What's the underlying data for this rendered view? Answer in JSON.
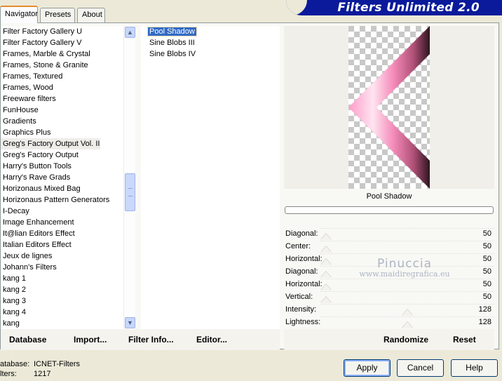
{
  "tabs": [
    {
      "label": "Navigator"
    },
    {
      "label": "Presets"
    },
    {
      "label": "About"
    }
  ],
  "banner": {
    "title": "Filters Unlimited 2.0"
  },
  "categories": [
    "Filter Factory Gallery U",
    "Filter Factory Gallery V",
    "Frames, Marble & Crystal",
    "Frames, Stone & Granite",
    "Frames, Textured",
    "Frames, Wood",
    "Freeware filters",
    "FunHouse",
    "Gradients",
    "Graphics Plus",
    "Greg's Factory Output Vol. II",
    "Greg's Factory Output",
    "Harry's Button Tools",
    "Harry's Rave Grads",
    "Horizonaus Mixed Bag",
    "Horizonaus Pattern Generators",
    "I-Decay",
    "Image Enhancement",
    "It@lian Editors Effect",
    "Italian Editors Effect",
    "Jeux de lignes",
    "Johann's Filters",
    "kang 1",
    "kang 2",
    "kang 3",
    "kang 4",
    "kang"
  ],
  "selected_category": "Greg's Factory Output Vol. II",
  "filters": [
    "Pool Shadow",
    "Sine Blobs III",
    "Sine Blobs IV"
  ],
  "selected_filter": "Pool Shadow",
  "preview": {
    "filter_name": "Pool Shadow"
  },
  "sliders": [
    {
      "label": "Diagonal:",
      "value": 50,
      "fraction": 0.0
    },
    {
      "label": "Center:",
      "value": 50,
      "fraction": 0.0
    },
    {
      "label": "Horizontal:",
      "value": 50,
      "fraction": 0.0
    },
    {
      "label": "Diagonal:",
      "value": 50,
      "fraction": 0.0
    },
    {
      "label": "Horizontal:",
      "value": 50,
      "fraction": 0.0
    },
    {
      "label": "Vertical:",
      "value": 50,
      "fraction": 0.0
    },
    {
      "label": "Intensity:",
      "value": 128,
      "fraction": 0.5
    },
    {
      "label": "Lightness:",
      "value": 128,
      "fraction": 0.5
    }
  ],
  "watermark": {
    "name": "Pinuccia",
    "url": "www.maidiregrafica.eu"
  },
  "buttons": {
    "database": "Database",
    "import": "Import...",
    "filter_info": "Filter Info...",
    "editor": "Editor...",
    "randomize": "Randomize",
    "reset": "Reset",
    "apply": "Apply",
    "cancel": "Cancel",
    "help": "Help"
  },
  "footer": {
    "database_label": "atabase:",
    "database_value": "ICNET-Filters",
    "filters_label": "lters:",
    "filters_value": "1217"
  }
}
